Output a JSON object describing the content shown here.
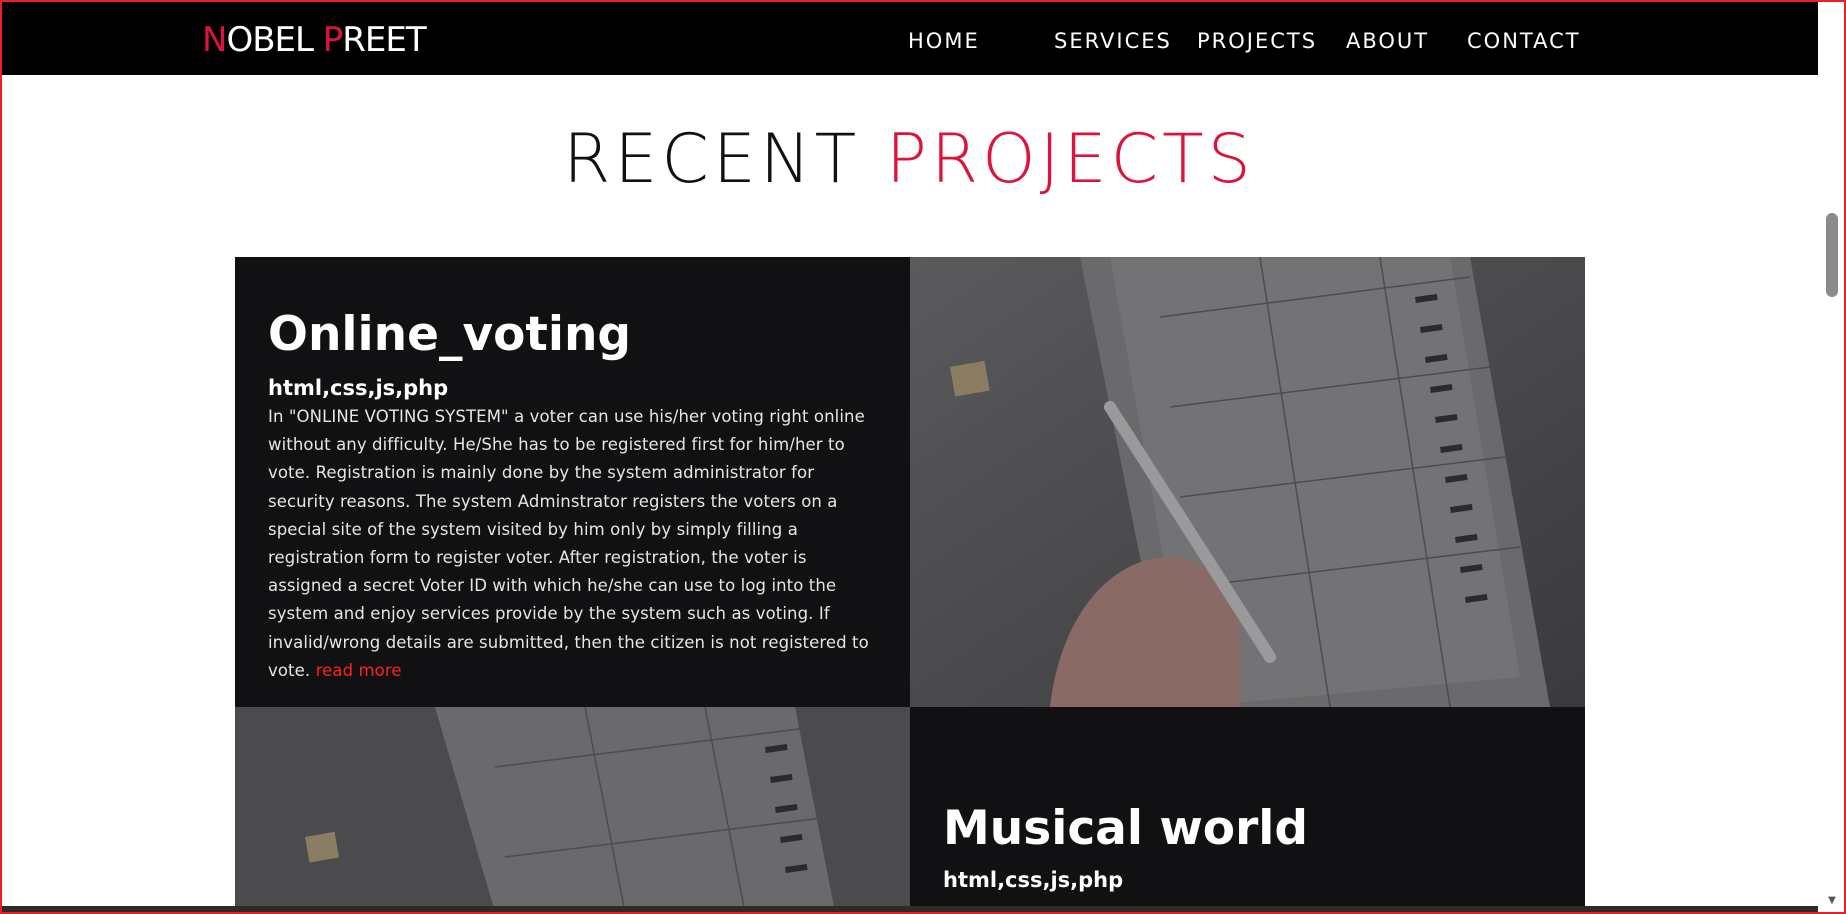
{
  "logo": {
    "n": "N",
    "obel": "OBEL ",
    "p": "P",
    "reet": "REET"
  },
  "nav": {
    "home": "HOME",
    "services": "SERVICES",
    "projects": "PROJECTS",
    "about": "ABOUT",
    "contact": "CONTACT"
  },
  "section": {
    "title_plain": "RECENT ",
    "title_accent": "PROJECTS"
  },
  "projects": [
    {
      "title": "Online_voting",
      "tech": "html,css,js,php",
      "description": "In \"ONLINE VOTING SYSTEM\" a voter can use his/her voting right online without any difficulty. He/She has to be registered first for him/her to vote. Registration is mainly done by the system administrator for security reasons. The system Adminstrator registers the voters on a special site of the system visited by him only by simply filling a registration form to register voter. After registration, the voter is assigned a secret Voter ID with which he/she can use to log into the system and enjoy services provide by the system such as voting. If invalid/wrong details are submitted, then the citizen is not registered to vote.",
      "read_more": "read more"
    },
    {
      "title": "Musical world",
      "tech": "html,css,js,php"
    }
  ],
  "colors": {
    "accent": "#dc143c",
    "nav_bg": "#000000",
    "card_bg": "#111113",
    "read_more": "#ff2020"
  }
}
